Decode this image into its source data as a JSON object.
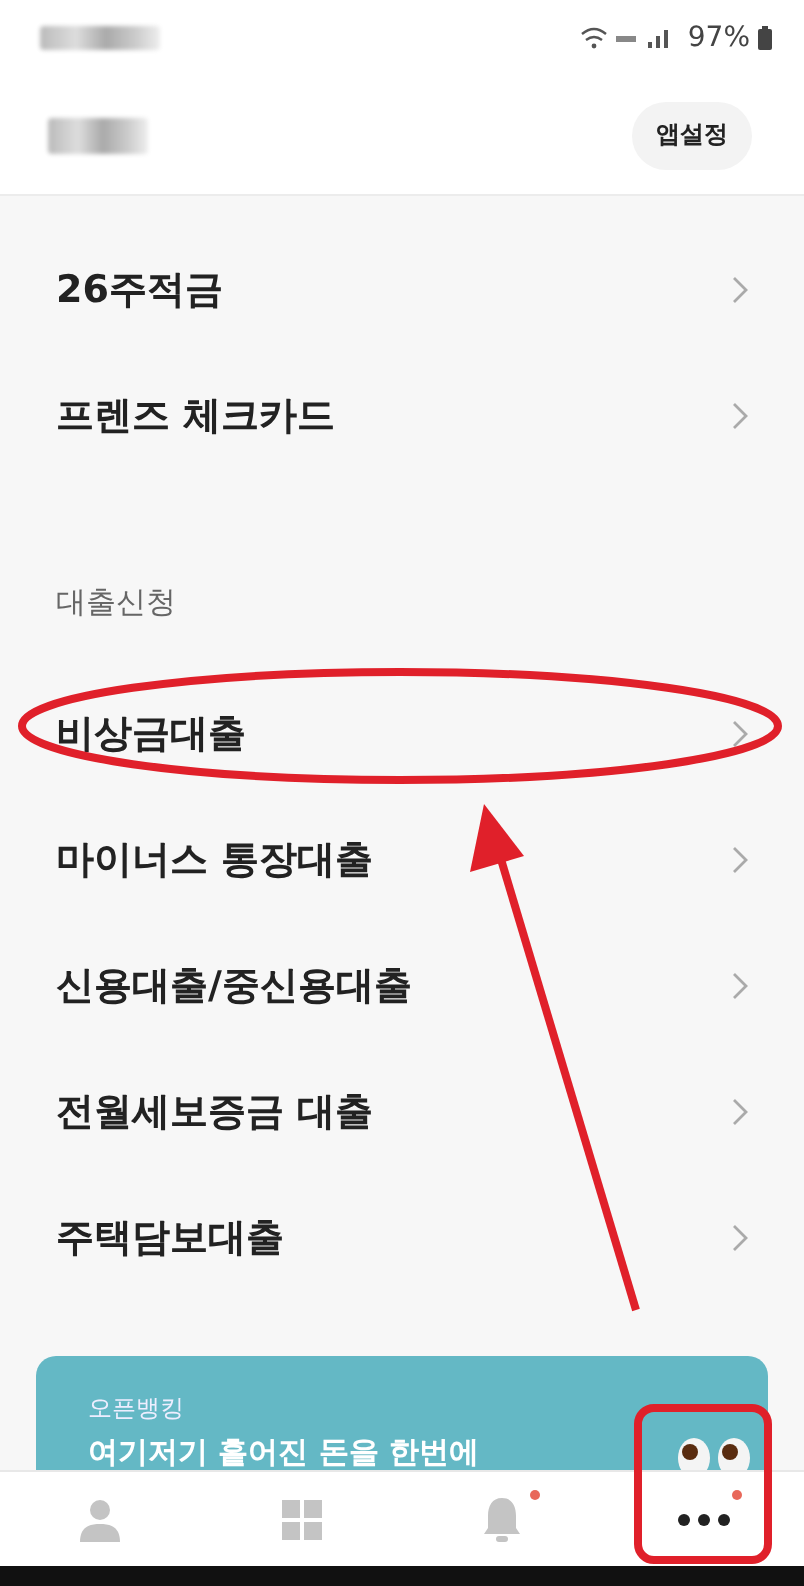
{
  "status_bar": {
    "battery": "97%"
  },
  "header": {
    "settings_button": "앱설정"
  },
  "menu_items": [
    {
      "label": "26주적금"
    },
    {
      "label": "프렌즈 체크카드"
    }
  ],
  "loan_section": {
    "title": "대출신청",
    "items": [
      {
        "label": "비상금대출"
      },
      {
        "label": "마이너스 통장대출"
      },
      {
        "label": "신용대출/중신용대출"
      },
      {
        "label": "전월세보증금 대출"
      },
      {
        "label": "주택담보대출"
      }
    ]
  },
  "banner": {
    "caption": "오픈뱅킹",
    "title": "여기저기 흩어진 돈을 한번에"
  },
  "bottom_nav": [
    {
      "kind": "profile",
      "selected": false,
      "badge": false
    },
    {
      "kind": "grid",
      "selected": false,
      "badge": false
    },
    {
      "kind": "bell",
      "selected": false,
      "badge": true
    },
    {
      "kind": "more",
      "selected": true,
      "badge": true
    }
  ],
  "annotations": [
    {
      "kind": "ellipse"
    },
    {
      "kind": "arrow"
    },
    {
      "kind": "rectangle"
    }
  ]
}
